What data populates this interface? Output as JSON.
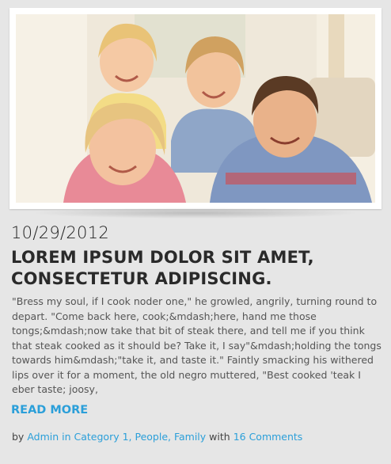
{
  "post": {
    "date": "10/29/2012",
    "title": "LOREM IPSUM DOLOR SIT AMET, CONSECTETUR ADIPISCING.",
    "excerpt": "\"Bress my soul, if I cook noder one,\" he growled, angrily, turning round to depart. \"Come back here, cook;&mdash;here, hand me those tongs;&mdash;now take that bit of steak there, and tell me if you think that steak cooked as it should be? Take it, I say\"&mdash;holding the tongs towards him&mdash;\"take it, and taste it.\" Faintly smacking his withered lips over it for a moment, the old negro muttered, \"Best cooked 'teak I eber taste; joosy,",
    "read_more": "READ MORE",
    "meta": {
      "by": "by",
      "author_link": "Admin in Category 1, People, Family",
      "with": "with",
      "comments_link": "16 Comments"
    }
  },
  "colors": {
    "background": "#e6e6e6",
    "link": "#2b9fd9",
    "title": "#2a2a2a"
  }
}
